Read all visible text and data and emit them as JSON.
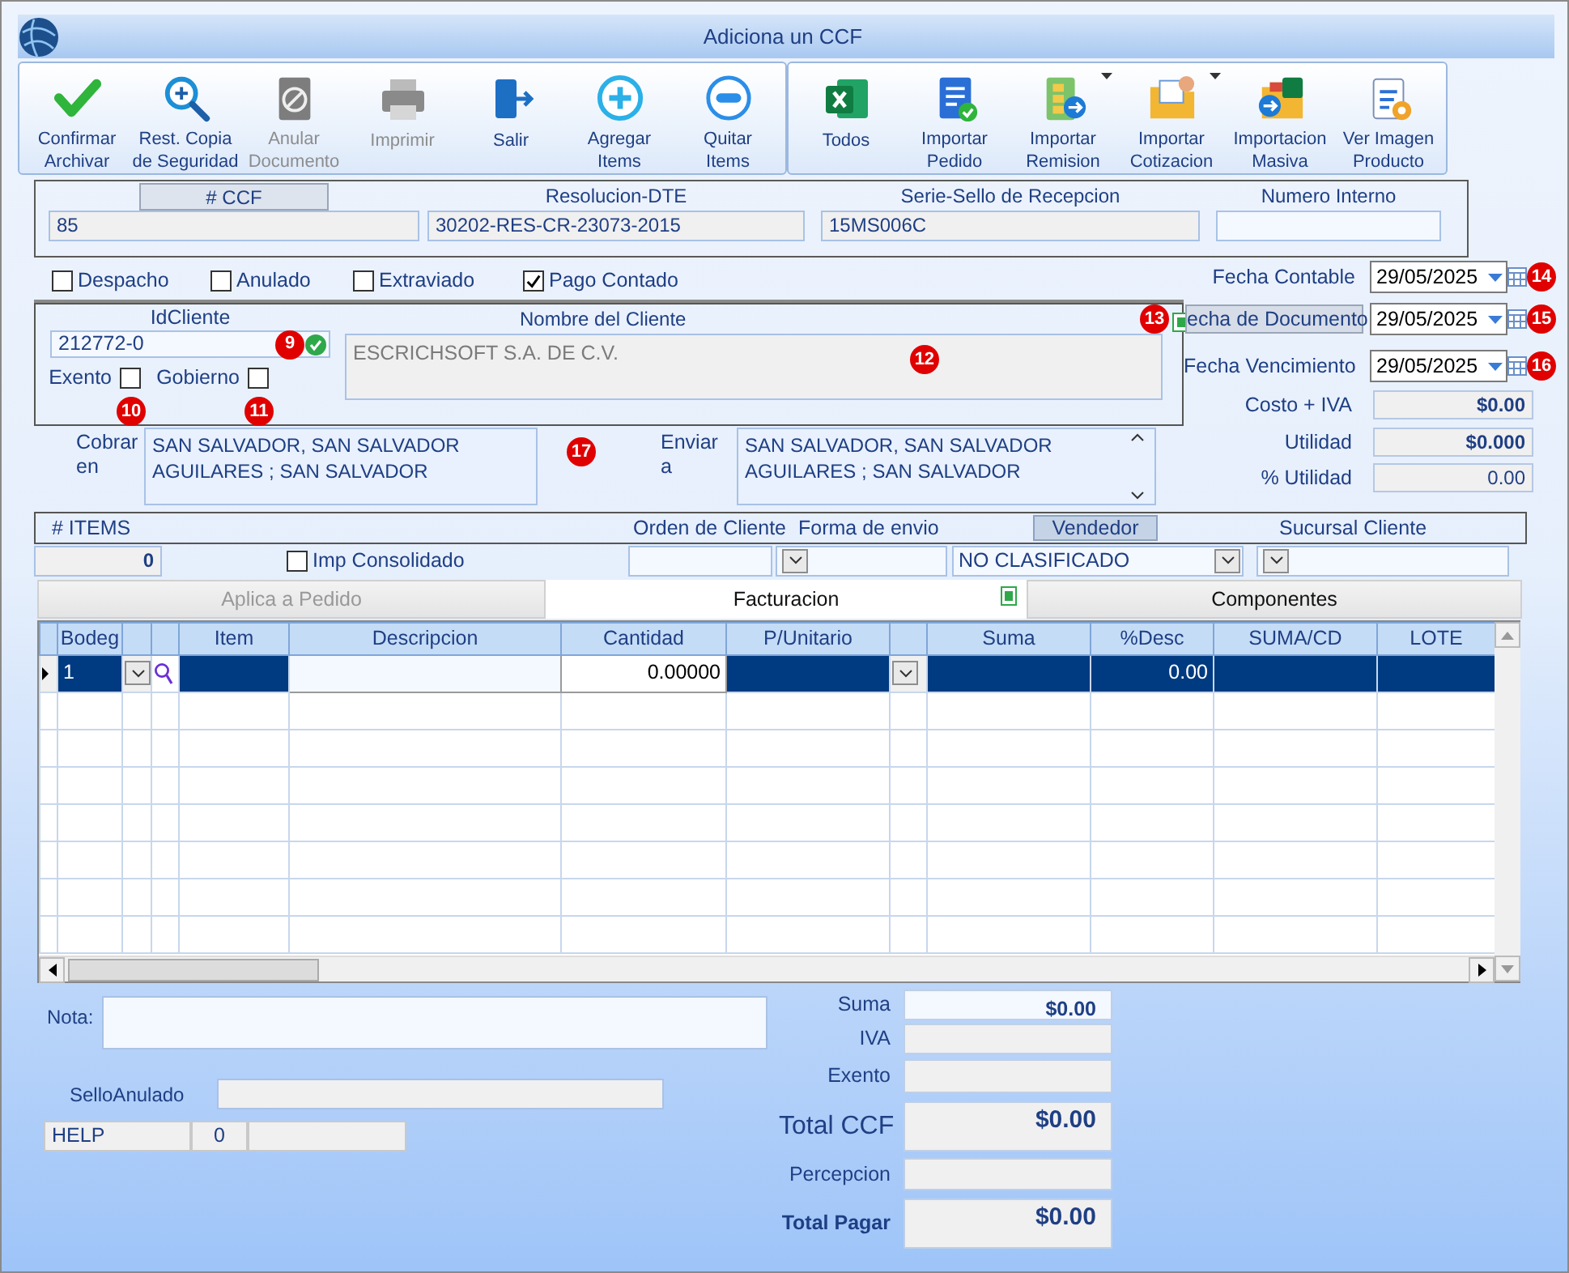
{
  "window": {
    "title": "Adiciona un CCF"
  },
  "toolbar": [
    {
      "buttons": [
        {
          "label": "Confirmar\nArchivar",
          "disabled": false,
          "has_menu": false
        },
        {
          "label": "Rest. Copia\nde Seguridad",
          "disabled": false,
          "has_menu": false
        },
        {
          "label": "Anular\nDocumento",
          "disabled": true,
          "has_menu": false
        },
        {
          "label": "Imprimir",
          "disabled": true,
          "has_menu": false
        },
        {
          "label": "Salir",
          "disabled": false,
          "has_menu": false
        },
        {
          "label": "Agregar\nItems",
          "disabled": false,
          "has_menu": false
        },
        {
          "label": "Quitar\nItems",
          "disabled": false,
          "has_menu": false
        }
      ]
    },
    {
      "buttons": [
        {
          "label": "Todos",
          "disabled": false,
          "has_menu": false
        },
        {
          "label": "Importar\nPedido",
          "disabled": false,
          "has_menu": false
        },
        {
          "label": "Importar\nRemision",
          "disabled": false,
          "has_menu": true
        },
        {
          "label": "Importar\nCotizacion",
          "disabled": false,
          "has_menu": true
        },
        {
          "label": "Importacion\nMasiva",
          "disabled": false,
          "has_menu": false
        },
        {
          "label": "Ver Imagen\nProducto",
          "disabled": false,
          "has_menu": false
        }
      ]
    }
  ],
  "document": {
    "fields": [
      {
        "label": "# CCF",
        "value": "85",
        "tab": true,
        "readonly": true
      },
      {
        "label": "Resolucion-DTE",
        "value": "30202-RES-CR-23073-2015",
        "tab": false,
        "readonly": true
      },
      {
        "label": "Serie-Sello de Recepcion",
        "value": "15MS006C",
        "tab": false,
        "readonly": true
      },
      {
        "label": "Numero Interno",
        "tab": false,
        "readonly": false
      }
    ]
  },
  "status_checks": [
    {
      "label": "Despacho",
      "checked": false
    },
    {
      "label": "Anulado",
      "checked": false
    },
    {
      "label": "Extraviado",
      "checked": false
    },
    {
      "label": "Pago Contado",
      "checked": true
    }
  ],
  "client": {
    "id_label": "IdCliente",
    "id": "212772-0",
    "id_marker": "9",
    "name_label": "Nombre del Cliente",
    "name": "ESCRICHSOFT S.A. DE C.V.",
    "name_marker": "12",
    "corner_marker": "13",
    "flags": [
      {
        "label": "Exento",
        "checked": false,
        "marker": "10"
      },
      {
        "label": "Gobierno",
        "checked": false,
        "marker": "11"
      }
    ]
  },
  "addresses": {
    "marker": "17",
    "items": [
      {
        "label": "Cobrar\nen",
        "value": "SAN SALVADOR, SAN SALVADOR\nAGUILARES ; SAN SALVADOR",
        "scrollable": false
      },
      {
        "label": "Enviar\na",
        "value": "SAN SALVADOR, SAN SALVADOR\nAGUILARES ; SAN SALVADOR",
        "scrollable": true
      }
    ]
  },
  "dates": [
    {
      "label": "Fecha Contable",
      "value": "29/05/2025",
      "tab": false,
      "marker": "14"
    },
    {
      "label": "echa de  Documento",
      "value": "29/05/2025",
      "tab": true,
      "marker": "15"
    },
    {
      "label": "Fecha Vencimiento",
      "value": "29/05/2025",
      "tab": false,
      "marker": "16"
    }
  ],
  "summary": [
    {
      "label": "Costo + IVA",
      "value": "$0.00",
      "bold": true
    },
    {
      "label": "Utilidad",
      "value": "$0.000",
      "bold": true
    },
    {
      "label": "% Utilidad",
      "value": "0.00",
      "bold": false
    }
  ],
  "order": {
    "items_label": "# ITEMS",
    "items_count": "0",
    "consolidated": {
      "label": "Imp Consolidado",
      "checked": false
    },
    "client_order_label": "Orden de Cliente",
    "shipping_label": "Forma de envio",
    "seller_label": "Vendedor",
    "seller": "NO CLASIFICADO",
    "branch_label": "Sucursal Cliente"
  },
  "tabs": [
    {
      "label": "Aplica a Pedido",
      "selected": false,
      "disabled": true
    },
    {
      "label": "Facturacion",
      "selected": true,
      "disabled": false
    },
    {
      "label": "Componentes",
      "selected": false,
      "disabled": false
    }
  ],
  "grid": {
    "columns": [
      {
        "kind": "indicator"
      },
      {
        "kind": "text",
        "label": "Bodeg"
      },
      {
        "kind": "dropdown"
      },
      {
        "kind": "lookup"
      },
      {
        "kind": "text",
        "label": "Item"
      },
      {
        "kind": "input",
        "label": "Descripcion"
      },
      {
        "kind": "input",
        "label": "Cantidad"
      },
      {
        "kind": "text",
        "label": "P/Unitario"
      },
      {
        "kind": "dropdown"
      },
      {
        "kind": "text",
        "label": "Suma"
      },
      {
        "kind": "text",
        "label": "%Desc"
      },
      {
        "kind": "text",
        "label": "SUMA/CD"
      },
      {
        "kind": "text",
        "label": "LOTE"
      }
    ],
    "rows": [
      {
        "selected": true,
        "cells": [
          null,
          "1",
          null,
          null,
          null,
          null,
          "0.00000",
          null,
          null,
          null,
          "0.00",
          null,
          null
        ]
      }
    ]
  },
  "notes": {
    "note_label": "Nota:",
    "void_seal_label": "SelloAnulado",
    "help": [
      "HELP",
      "0"
    ]
  },
  "totals": [
    {
      "label": "Suma",
      "value": "$0.00",
      "kind": "sum"
    },
    {
      "label": "IVA",
      "kind": "line"
    },
    {
      "label": "Exento",
      "kind": "line"
    },
    {
      "label": "Total CCF",
      "value": "$0.00",
      "kind": "total"
    },
    {
      "label": "Percepcion",
      "kind": "line"
    },
    {
      "label": "Total Pagar",
      "value": "$0.00",
      "kind": "grand"
    }
  ]
}
